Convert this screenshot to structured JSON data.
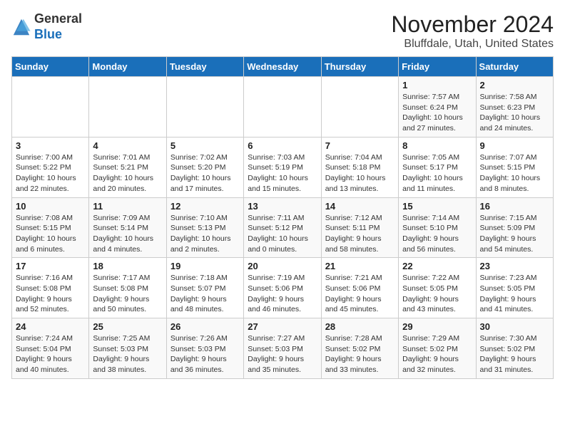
{
  "logo": {
    "general": "General",
    "blue": "Blue"
  },
  "title": "November 2024",
  "location": "Bluffdale, Utah, United States",
  "days_header": [
    "Sunday",
    "Monday",
    "Tuesday",
    "Wednesday",
    "Thursday",
    "Friday",
    "Saturday"
  ],
  "weeks": [
    [
      {
        "day": "",
        "info": ""
      },
      {
        "day": "",
        "info": ""
      },
      {
        "day": "",
        "info": ""
      },
      {
        "day": "",
        "info": ""
      },
      {
        "day": "",
        "info": ""
      },
      {
        "day": "1",
        "info": "Sunrise: 7:57 AM\nSunset: 6:24 PM\nDaylight: 10 hours and 27 minutes."
      },
      {
        "day": "2",
        "info": "Sunrise: 7:58 AM\nSunset: 6:23 PM\nDaylight: 10 hours and 24 minutes."
      }
    ],
    [
      {
        "day": "3",
        "info": "Sunrise: 7:00 AM\nSunset: 5:22 PM\nDaylight: 10 hours and 22 minutes."
      },
      {
        "day": "4",
        "info": "Sunrise: 7:01 AM\nSunset: 5:21 PM\nDaylight: 10 hours and 20 minutes."
      },
      {
        "day": "5",
        "info": "Sunrise: 7:02 AM\nSunset: 5:20 PM\nDaylight: 10 hours and 17 minutes."
      },
      {
        "day": "6",
        "info": "Sunrise: 7:03 AM\nSunset: 5:19 PM\nDaylight: 10 hours and 15 minutes."
      },
      {
        "day": "7",
        "info": "Sunrise: 7:04 AM\nSunset: 5:18 PM\nDaylight: 10 hours and 13 minutes."
      },
      {
        "day": "8",
        "info": "Sunrise: 7:05 AM\nSunset: 5:17 PM\nDaylight: 10 hours and 11 minutes."
      },
      {
        "day": "9",
        "info": "Sunrise: 7:07 AM\nSunset: 5:15 PM\nDaylight: 10 hours and 8 minutes."
      }
    ],
    [
      {
        "day": "10",
        "info": "Sunrise: 7:08 AM\nSunset: 5:15 PM\nDaylight: 10 hours and 6 minutes."
      },
      {
        "day": "11",
        "info": "Sunrise: 7:09 AM\nSunset: 5:14 PM\nDaylight: 10 hours and 4 minutes."
      },
      {
        "day": "12",
        "info": "Sunrise: 7:10 AM\nSunset: 5:13 PM\nDaylight: 10 hours and 2 minutes."
      },
      {
        "day": "13",
        "info": "Sunrise: 7:11 AM\nSunset: 5:12 PM\nDaylight: 10 hours and 0 minutes."
      },
      {
        "day": "14",
        "info": "Sunrise: 7:12 AM\nSunset: 5:11 PM\nDaylight: 9 hours and 58 minutes."
      },
      {
        "day": "15",
        "info": "Sunrise: 7:14 AM\nSunset: 5:10 PM\nDaylight: 9 hours and 56 minutes."
      },
      {
        "day": "16",
        "info": "Sunrise: 7:15 AM\nSunset: 5:09 PM\nDaylight: 9 hours and 54 minutes."
      }
    ],
    [
      {
        "day": "17",
        "info": "Sunrise: 7:16 AM\nSunset: 5:08 PM\nDaylight: 9 hours and 52 minutes."
      },
      {
        "day": "18",
        "info": "Sunrise: 7:17 AM\nSunset: 5:08 PM\nDaylight: 9 hours and 50 minutes."
      },
      {
        "day": "19",
        "info": "Sunrise: 7:18 AM\nSunset: 5:07 PM\nDaylight: 9 hours and 48 minutes."
      },
      {
        "day": "20",
        "info": "Sunrise: 7:19 AM\nSunset: 5:06 PM\nDaylight: 9 hours and 46 minutes."
      },
      {
        "day": "21",
        "info": "Sunrise: 7:21 AM\nSunset: 5:06 PM\nDaylight: 9 hours and 45 minutes."
      },
      {
        "day": "22",
        "info": "Sunrise: 7:22 AM\nSunset: 5:05 PM\nDaylight: 9 hours and 43 minutes."
      },
      {
        "day": "23",
        "info": "Sunrise: 7:23 AM\nSunset: 5:05 PM\nDaylight: 9 hours and 41 minutes."
      }
    ],
    [
      {
        "day": "24",
        "info": "Sunrise: 7:24 AM\nSunset: 5:04 PM\nDaylight: 9 hours and 40 minutes."
      },
      {
        "day": "25",
        "info": "Sunrise: 7:25 AM\nSunset: 5:03 PM\nDaylight: 9 hours and 38 minutes."
      },
      {
        "day": "26",
        "info": "Sunrise: 7:26 AM\nSunset: 5:03 PM\nDaylight: 9 hours and 36 minutes."
      },
      {
        "day": "27",
        "info": "Sunrise: 7:27 AM\nSunset: 5:03 PM\nDaylight: 9 hours and 35 minutes."
      },
      {
        "day": "28",
        "info": "Sunrise: 7:28 AM\nSunset: 5:02 PM\nDaylight: 9 hours and 33 minutes."
      },
      {
        "day": "29",
        "info": "Sunrise: 7:29 AM\nSunset: 5:02 PM\nDaylight: 9 hours and 32 minutes."
      },
      {
        "day": "30",
        "info": "Sunrise: 7:30 AM\nSunset: 5:02 PM\nDaylight: 9 hours and 31 minutes."
      }
    ]
  ]
}
